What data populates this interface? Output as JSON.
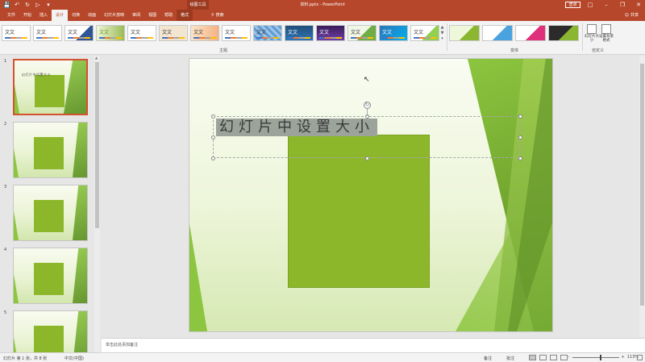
{
  "titlebar": {
    "qat_icons": [
      "save-icon",
      "undo-icon",
      "redo-icon",
      "start-from-beginning-icon",
      "customize-qat-icon"
    ],
    "context_group": "绘图工具",
    "document_title": "资料.pptx - PowerPoint",
    "login_label": "登录",
    "window_controls": [
      "ribbon-display-icon",
      "minimize-icon",
      "restore-icon",
      "close-icon"
    ]
  },
  "tabs": [
    {
      "label": "文件"
    },
    {
      "label": "开始"
    },
    {
      "label": "插入"
    },
    {
      "label": "设计",
      "active": true
    },
    {
      "label": "切换"
    },
    {
      "label": "动画"
    },
    {
      "label": "幻灯片放映"
    },
    {
      "label": "审阅"
    },
    {
      "label": "视图"
    },
    {
      "label": "帮助"
    },
    {
      "label": "格式",
      "context": true
    }
  ],
  "tell_me": "搜索",
  "share": "共享",
  "ribbon": {
    "themes_group_label": "主题",
    "variants_group_label": "变体",
    "customize_group_label": "自定义",
    "theme_thumb_label": "文文",
    "slide_size_label": "幻灯片大小",
    "format_background_label": "设置背景格式"
  },
  "thumbnails": [
    {
      "number": "1",
      "selected": true,
      "text": "幻灯片中设置大小"
    },
    {
      "number": "2"
    },
    {
      "number": "3"
    },
    {
      "number": "4"
    },
    {
      "number": "5"
    }
  ],
  "slide": {
    "title": "幻灯片中设置大小"
  },
  "notes_placeholder": "单击此处添加备注",
  "statusbar": {
    "slide_info": "幻灯片 第 1 张，共 8 张",
    "language": "中文(中国)",
    "notes_label": "备注",
    "comments_label": "批注",
    "zoom": "113%",
    "zoom_level": 0.6
  },
  "colors": {
    "accent": "#b7472a",
    "slide_square": "#8db72b"
  }
}
